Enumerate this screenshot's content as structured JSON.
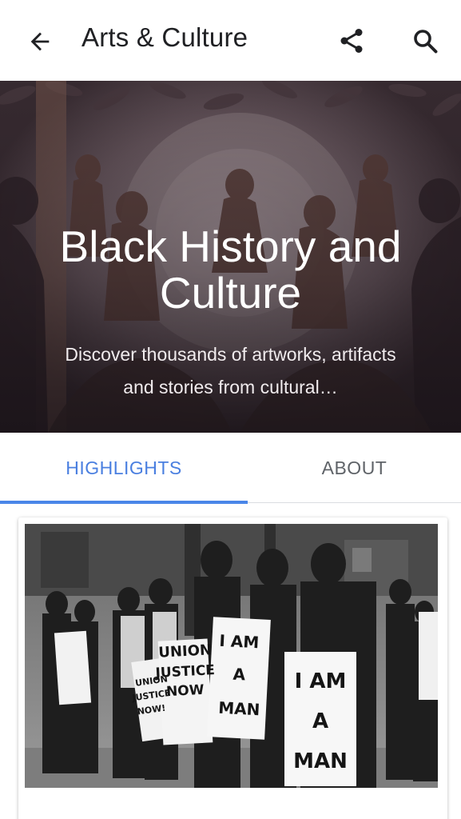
{
  "appbar": {
    "title": "Arts & Culture",
    "back_icon": "arrow-back-icon",
    "share_icon": "share-icon",
    "search_icon": "search-icon"
  },
  "hero": {
    "title": "Black History and Culture",
    "description": "Discover thousands of artworks, artifacts and stories from cultural…"
  },
  "tabs": [
    {
      "label": "HIGHLIGHTS",
      "active": true
    },
    {
      "label": "ABOUT",
      "active": false
    }
  ],
  "card": {
    "signs": {
      "i_am_a_man": [
        "I AM",
        "A",
        "MAN"
      ],
      "union_justice_now": [
        "UNION",
        "JUSTICE",
        "NOW"
      ],
      "union_justice_now_small": [
        "UNION",
        "JUSTICE",
        "NOW!"
      ]
    }
  },
  "colors": {
    "accent": "#4a86e8",
    "accent_text": "#4a7fe0",
    "inactive_text": "#5f6368"
  }
}
